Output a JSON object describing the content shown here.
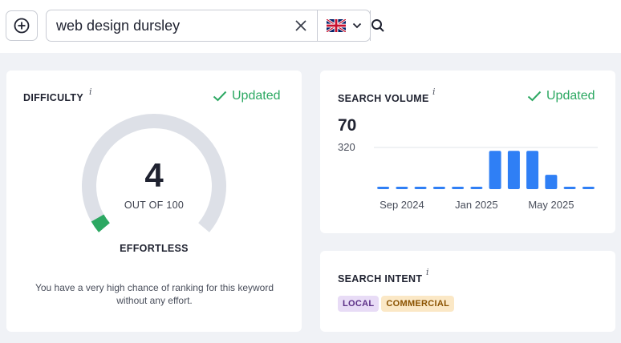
{
  "search": {
    "query": "web design dursley",
    "country_flag": "uk-flag-icon"
  },
  "colors": {
    "accent_green": "#2ca862",
    "gauge_track": "#dde0e7",
    "gauge_fill": "#2ca862",
    "bar_blue": "#2f7ff5",
    "local_tag_bg": "#e8dcf6",
    "commercial_tag_bg": "#fbe8c6"
  },
  "difficulty": {
    "title": "DIFFICULTY",
    "info": "i",
    "status": "Updated",
    "value": "4",
    "out_of": "OUT OF 100",
    "value_fraction": 0.04,
    "level": "EFFORTLESS",
    "description": "You have a very high chance of ranking for this keyword without any effort."
  },
  "search_volume": {
    "title": "SEARCH VOLUME",
    "info": "i",
    "status": "Updated",
    "value": "70",
    "chart_data": {
      "type": "bar",
      "y_tick_label": "320",
      "ylim": [
        0,
        320
      ],
      "grid": true,
      "x_tick_labels": [
        "Sep 2024",
        "Jan 2025",
        "May 2025"
      ],
      "values": [
        10,
        10,
        10,
        10,
        10,
        20,
        320,
        320,
        320,
        120,
        10,
        10
      ]
    }
  },
  "search_intent": {
    "title": "SEARCH INTENT",
    "info": "i",
    "tags": [
      "LOCAL",
      "COMMERCIAL"
    ]
  }
}
